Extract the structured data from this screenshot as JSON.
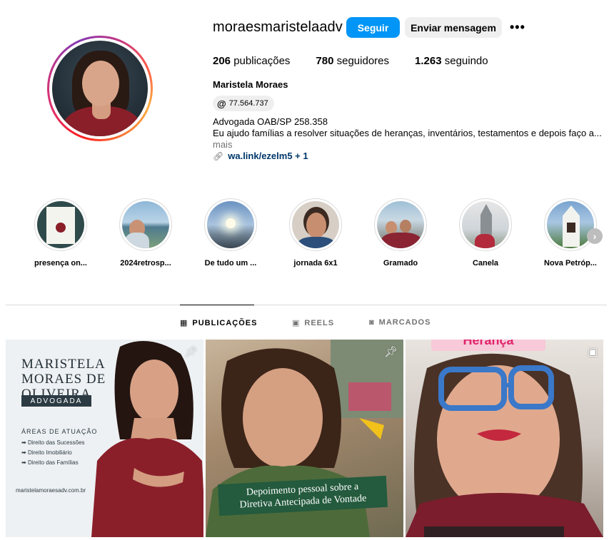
{
  "profile": {
    "username": "moraesmaristelaadv",
    "follow_label": "Seguir",
    "message_label": "Enviar mensagem",
    "more_label": "•••",
    "stats": [
      {
        "count": "206",
        "label": "publicações"
      },
      {
        "count": "780",
        "label": "seguidores"
      },
      {
        "count": "1.263",
        "label": "seguindo"
      }
    ],
    "full_name": "Maristela Moraes",
    "threads_badge": "77.564.737",
    "bio_line1": "Advogada OAB/SP 258.358",
    "bio_line2": "Eu ajudo famílias a resolver situações de heranças, inventários, testamentos e depois faço a...",
    "bio_more": "mais",
    "link_text": "wa.link/ezelm5 + 1"
  },
  "highlights": [
    {
      "label": "presença on..."
    },
    {
      "label": "2024retrosp..."
    },
    {
      "label": "De tudo um ..."
    },
    {
      "label": "jornada 6x1"
    },
    {
      "label": "Gramado"
    },
    {
      "label": "Canela"
    },
    {
      "label": "Nova Petróp..."
    }
  ],
  "tabs": {
    "posts": "PUBLICAÇÕES",
    "reels": "REELS",
    "tagged": "MARCADOS"
  },
  "posts": {
    "p1": {
      "name_line1": "MARISTELA",
      "name_line2": "MORAES DE",
      "name_line3": "OLIVEIRA",
      "role": "ADVOGADA",
      "areas_title": "ÁREAS DE ATUAÇÃO",
      "areas": [
        "Direito das Sucessões",
        "Direito Imobiliário",
        "Direito das Famílias"
      ],
      "site": "maristelamoraesadv.com.br"
    },
    "p2": {
      "caption_line1": "Depoimento pessoal sobre a",
      "caption_line2": "Diretiva Antecipada de Vontade"
    },
    "p3": {
      "tag": "Herança"
    }
  },
  "colors": {
    "follow_button": "#0095f6",
    "link": "#00376b",
    "muted": "#737373"
  }
}
